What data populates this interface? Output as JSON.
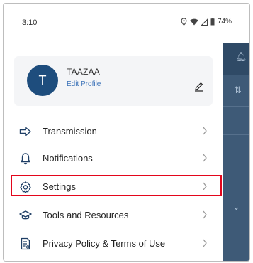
{
  "status_bar": {
    "time": "3:10",
    "battery": "74%"
  },
  "profile": {
    "avatar_initial": "T",
    "name": "TAAZAA",
    "edit_label": "Edit Profile"
  },
  "menu": {
    "items": [
      {
        "label": "Transmission",
        "icon": "arrow-right-icon"
      },
      {
        "label": "Notifications",
        "icon": "bell-icon"
      },
      {
        "label": "Settings",
        "icon": "gear-icon"
      },
      {
        "label": "Tools and Resources",
        "icon": "graduation-cap-icon"
      },
      {
        "label": "Privacy Policy & Terms of Use",
        "icon": "document-icon"
      }
    ]
  },
  "colors": {
    "avatar_bg": "#1e4d7d",
    "accent": "#3b72b8",
    "highlight": "#e3061c",
    "background_app": "#3e5a77"
  }
}
